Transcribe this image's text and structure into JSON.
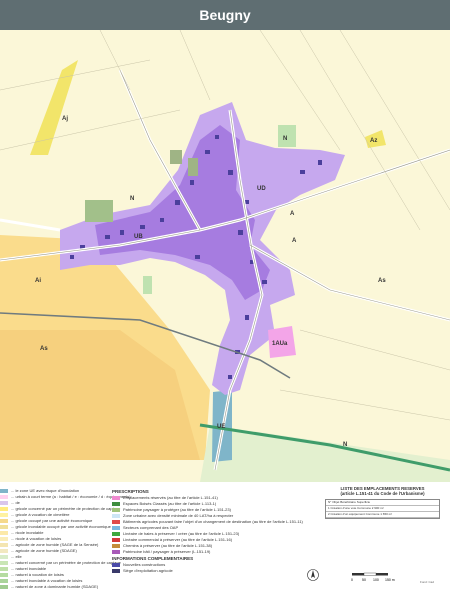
{
  "title": "Beugny",
  "zone_labels": [
    "UE",
    "Az",
    "Aj",
    "N",
    "UD",
    "A",
    "Ai",
    "As",
    "1AUa",
    "UB",
    "N",
    "A",
    "As",
    "N"
  ],
  "prescriptions": {
    "title": "PRESCRIPTIONS",
    "items": [
      {
        "label": "Emplacements réservés (au titre de l'article L.151-41)",
        "color": "#f08ad0"
      },
      {
        "label": "Espaces Boisés Classés (au titre de l'article L.113-1)",
        "color": "#3e8e3e"
      },
      {
        "label": "Patrimoine paysager à protéger (au titre de l'article L.151-23)",
        "color": "#9fc37a"
      },
      {
        "label": "Zone urbaine avec densité minimale de 40 LAT/ha à respecter",
        "color": "#cde6f5"
      },
      {
        "label": "Bâtiments agricoles pouvant faire l'objet d'un changement de destination (au titre de l'article L.151-11)",
        "color": "#e04a4a"
      },
      {
        "label": "Secteurs comprenant des OAP",
        "color": "#7ab8e0"
      },
      {
        "label": "Linéaire de haies à préserver / créer (au titre de l'article L.151-23)",
        "color": "#3ea83e"
      },
      {
        "label": "Linéaire commercial à préserver (au titre de l'article L.151-16)",
        "color": "#d43a3a"
      },
      {
        "label": "Chemins à préserver (au titre de l'article L.151-38)",
        "color": "#c48d3a"
      },
      {
        "label": "Patrimoine bâti / paysager à préserver (L.151-19)",
        "color": "#a85ab8"
      }
    ]
  },
  "complementary": {
    "title": "INFORMATIONS COMPLEMENTAIRES",
    "items": [
      {
        "label": "Nouvelles constructions",
        "color": "#4a4aa8"
      },
      {
        "label": "Siège d'exploitation agricole",
        "color": "#3a3a6a"
      }
    ]
  },
  "zones_legend": [
    {
      "label": "... le zone UE avec risque d'inondation",
      "color": "#7fb5c9"
    },
    {
      "label": "... urbain à court terme (a : habitat / e : économie / d : équipements)",
      "color": "#ffd2ef"
    },
    {
      "label": "... de",
      "color": "#d9c6ec"
    },
    {
      "label": "... gricole concerné par un périmètre de protection de captage",
      "color": "#ffec80"
    },
    {
      "label": "... gricole à vocation de cimetière",
      "color": "#fff2a0"
    },
    {
      "label": "... gricole occupé par une activité économique",
      "color": "#f5d98c"
    },
    {
      "label": "... gricole inondable occupé par une activité économique",
      "color": "#f0e09a"
    },
    {
      "label": "... ricole inondable",
      "color": "#fce9a8"
    },
    {
      "label": "... ricole à vocation de loisirs",
      "color": "#faedb8"
    },
    {
      "label": "... agricole de zone humide (SAGE de la Sensée)",
      "color": "#f4e5b0"
    },
    {
      "label": "... agricole de zone humide (SDAGE)",
      "color": "#f2e8c0"
    },
    {
      "label": "... elle",
      "color": "#d8ecc9"
    },
    {
      "label": "... naturel concerné par un périmètre de protection de captage",
      "color": "#c9e6b5"
    },
    {
      "label": "... naturel inondable",
      "color": "#bfe0a8"
    },
    {
      "label": "... naturel à vocation de loisirs",
      "color": "#b5dca0"
    },
    {
      "label": "... naturel inondable à vocation de loisirs",
      "color": "#aad49a"
    },
    {
      "label": "... naturel de zone à dominante humide (SDAGE)",
      "color": "#a0cc90"
    }
  ],
  "reserved_table": {
    "title_line1": "LISTE DES EMPLACEMENTS RESERVES",
    "title_line2": "(article L.151-41 du Code de l'Urbanisme)",
    "rows": [
      "N°  Objet  Bénéficiaire  Superficie",
      "1  Création d'une voie  Commune  2 900 m²",
      "2  Création d'un équipement  Commune  1 650 m²"
    ]
  },
  "scale_ticks": [
    "0",
    "50",
    "100",
    "150 m"
  ],
  "credit": "Fond: Cad"
}
